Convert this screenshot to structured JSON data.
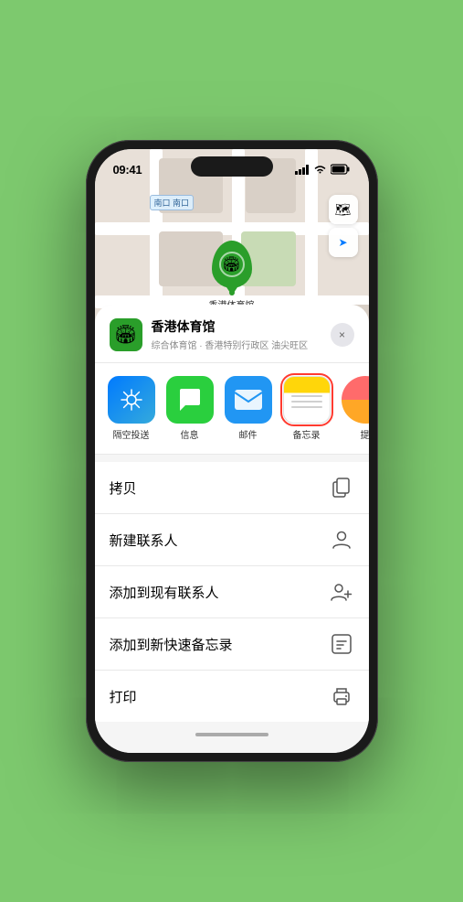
{
  "status_bar": {
    "time": "09:41",
    "location_icon": "▶",
    "signal_label": "signal",
    "wifi_label": "wifi",
    "battery_label": "battery"
  },
  "map": {
    "south_gate": "南口",
    "south_gate_prefix": "南口",
    "stadium_name": "香港体育馆",
    "stadium_icon": "🏟"
  },
  "map_controls": {
    "layers_icon": "🗺",
    "location_icon": "➤"
  },
  "venue": {
    "name": "香港体育馆",
    "description": "综合体育馆 · 香港特别行政区 油尖旺区",
    "icon": "🏟",
    "close_label": "×"
  },
  "apps": [
    {
      "id": "airdrop",
      "label": "隔空投送",
      "selected": false
    },
    {
      "id": "messages",
      "label": "信息",
      "selected": false
    },
    {
      "id": "mail",
      "label": "邮件",
      "selected": false
    },
    {
      "id": "notes",
      "label": "备忘录",
      "selected": true
    },
    {
      "id": "more",
      "label": "提",
      "selected": false
    }
  ],
  "actions": [
    {
      "label": "拷贝",
      "icon": "copy"
    },
    {
      "label": "新建联系人",
      "icon": "person"
    },
    {
      "label": "添加到现有联系人",
      "icon": "person-add"
    },
    {
      "label": "添加到新快速备忘录",
      "icon": "note"
    },
    {
      "label": "打印",
      "icon": "print"
    }
  ],
  "colors": {
    "green": "#2a9e2a",
    "red_outline": "#ff3b30",
    "map_bg": "#e8e0d8"
  }
}
